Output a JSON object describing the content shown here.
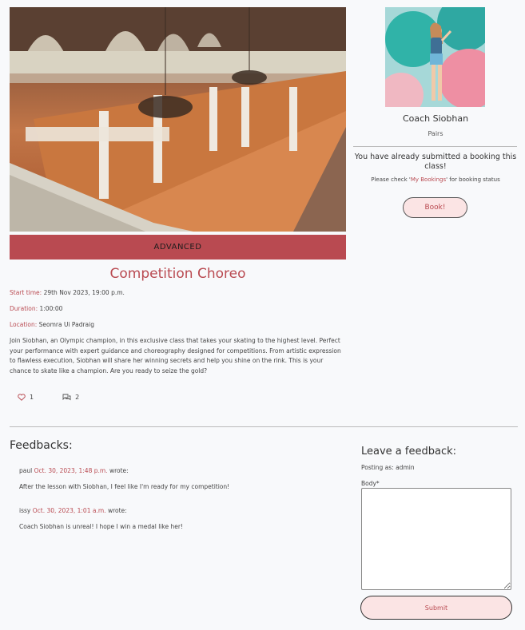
{
  "class": {
    "level": "ADVANCED",
    "title": "Competition Choreo",
    "start_label": "Start time:",
    "start_value": "29th Nov 2023, 19:00 p.m.",
    "duration_label": "Duration:",
    "duration_value": "1:00:00",
    "location_label": "Location:",
    "location_value": "Seomra Ui Padraig",
    "description": "Join Siobhan, an Olympic champion, in this exclusive class that takes your skating to the highest level. Perfect your performance with expert guidance and choreography designed for competitions. From artistic expression to flawless execution, Siobhan will share her winning secrets and help you shine on the rink. This is your chance to skate like a champion. Are you ready to seize the gold?",
    "likes": "1",
    "comments": "2"
  },
  "coach": {
    "name": "Coach Siobhan",
    "category": "Pairs",
    "booked_message": "You have already submitted a booking this class!",
    "check_prefix": "Please check '",
    "check_link": "My Bookings",
    "check_suffix": "' for booking status",
    "book_label": "Book!"
  },
  "feedbacks": {
    "heading": "Feedbacks:",
    "items": [
      {
        "user": "paul",
        "date": "Oct. 30, 2023, 1:48 p.m.",
        "suffix": "wrote:",
        "body": "After the lesson with Siobhan, I feel like I'm ready for my competition!"
      },
      {
        "user": "issy",
        "date": "Oct. 30, 2023, 1:01 a.m.",
        "suffix": "wrote:",
        "body": "Coach Siobhan is unreal! I hope I win a medal like her!"
      }
    ]
  },
  "form": {
    "heading": "Leave a feedback:",
    "posting_as": "Posting as: admin",
    "body_label": "Body*",
    "submit_label": "Submit"
  },
  "colors": {
    "accent": "#b94a51",
    "button_bg": "#fbe4e4",
    "page_bg": "#f8f9fb"
  }
}
